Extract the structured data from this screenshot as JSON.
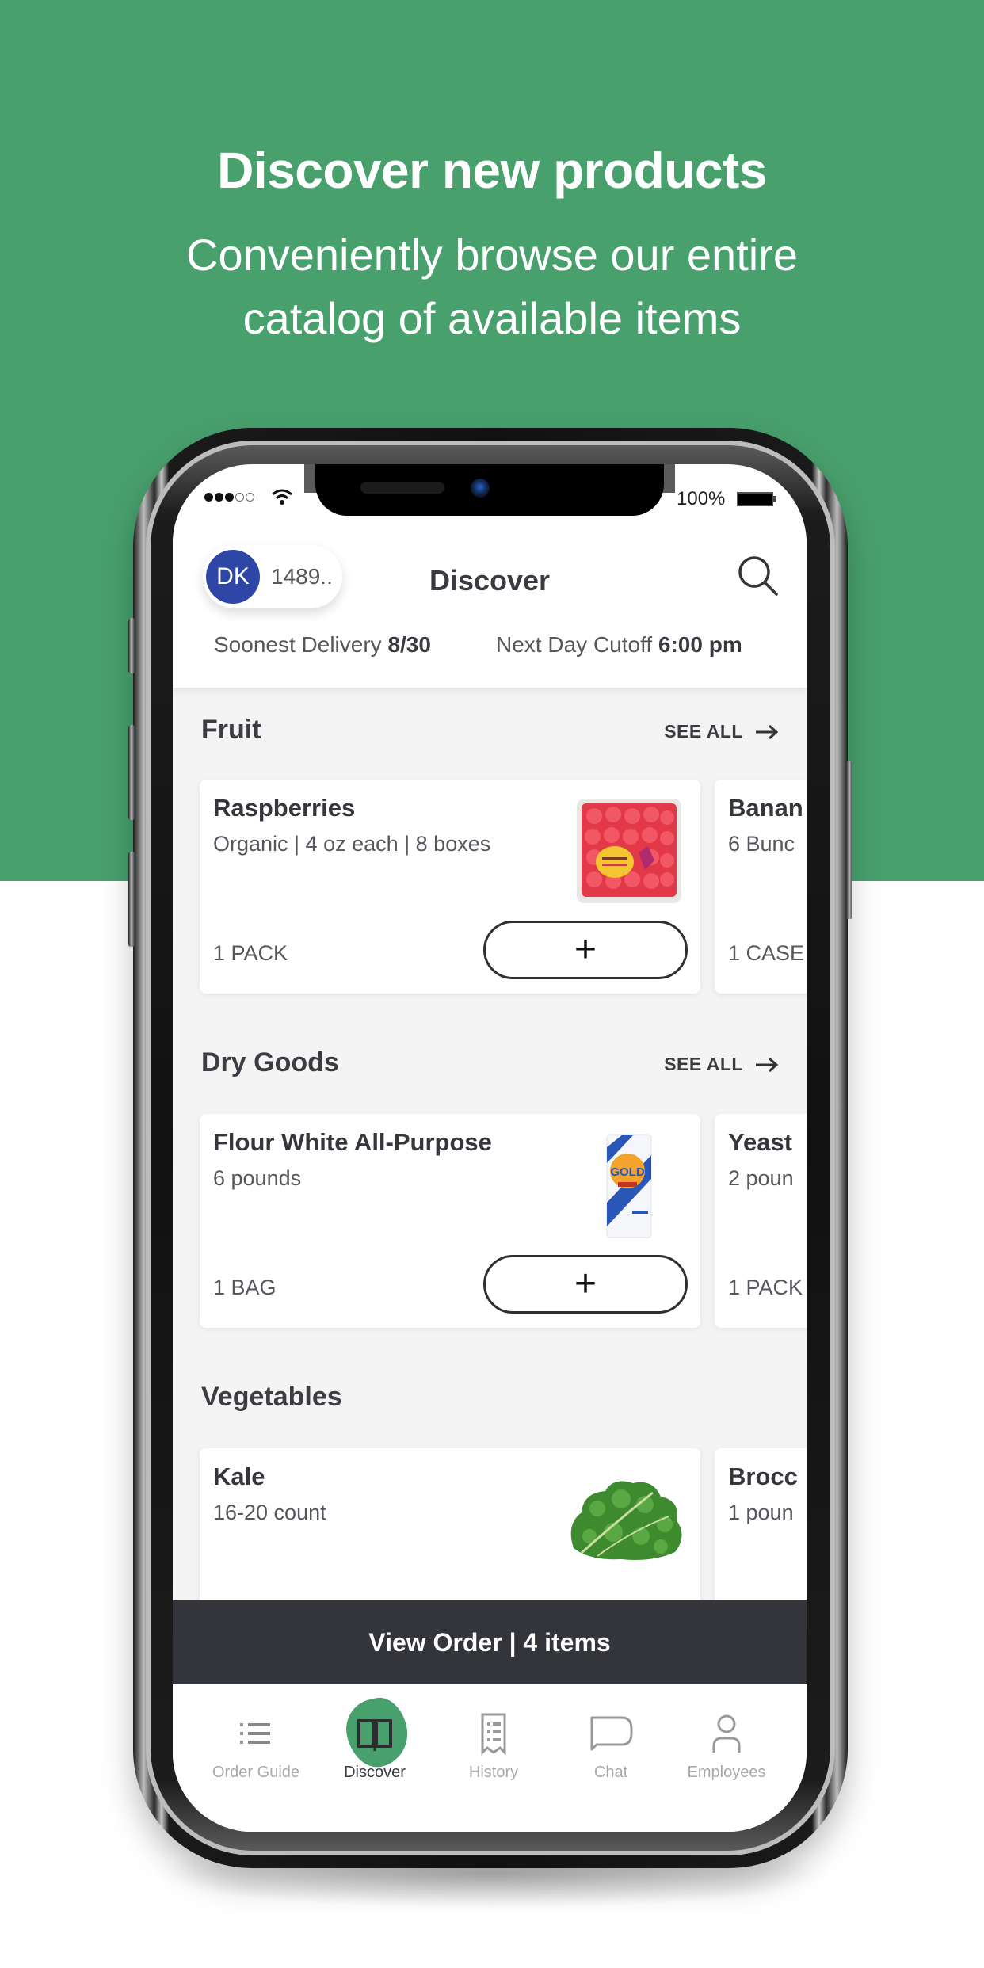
{
  "promo": {
    "title": "Discover new products",
    "subtitle_line1": "Conveniently browse our entire",
    "subtitle_line2": "catalog of available items",
    "brand_color": "#48a06d"
  },
  "status_bar": {
    "signal_filled": 3,
    "signal_total": 5,
    "battery_percent": "100%"
  },
  "header": {
    "avatar_initials": "DK",
    "account_id": "1489..",
    "title": "Discover",
    "search_icon": "search-icon",
    "soonest_delivery_label": "Soonest Delivery",
    "soonest_delivery_value": "8/30",
    "cutoff_label": "Next Day Cutoff",
    "cutoff_value": "6:00 pm"
  },
  "sections": [
    {
      "title": "Fruit",
      "see_all": "SEE ALL",
      "products": [
        {
          "name": "Raspberries",
          "desc": "Organic | 4 oz each | 8 boxes",
          "unit": "1 PACK",
          "image": "raspberries",
          "add_label": "+"
        },
        {
          "name": "Banan",
          "desc": "6 Bunc",
          "unit": "1 CASE",
          "image": "",
          "add_label": "+"
        }
      ]
    },
    {
      "title": "Dry Goods",
      "see_all": "SEE ALL",
      "products": [
        {
          "name": "Flour White All-Purpose",
          "desc": "6 pounds",
          "unit": "1 BAG",
          "image": "flour-bag",
          "add_label": "+"
        },
        {
          "name": "Yeast",
          "desc": "2 poun",
          "unit": "1 PACK",
          "image": "",
          "add_label": "+"
        }
      ]
    },
    {
      "title": "Vegetables",
      "see_all": "",
      "products": [
        {
          "name": "Kale",
          "desc": "16-20 count",
          "unit": "",
          "image": "kale",
          "add_label": "+"
        },
        {
          "name": "Brocc",
          "desc": "1 poun",
          "unit": "",
          "image": "",
          "add_label": "+"
        }
      ]
    }
  ],
  "view_order": {
    "label": "View Order | 4 items",
    "item_count": 4
  },
  "tabs": [
    {
      "label": "Order Guide",
      "icon": "list-icon",
      "active": false
    },
    {
      "label": "Discover",
      "icon": "book-icon",
      "active": true
    },
    {
      "label": "History",
      "icon": "receipt-icon",
      "active": false
    },
    {
      "label": "Chat",
      "icon": "chat-bubble-icon",
      "active": false
    },
    {
      "label": "Employees",
      "icon": "person-icon",
      "active": false
    }
  ]
}
